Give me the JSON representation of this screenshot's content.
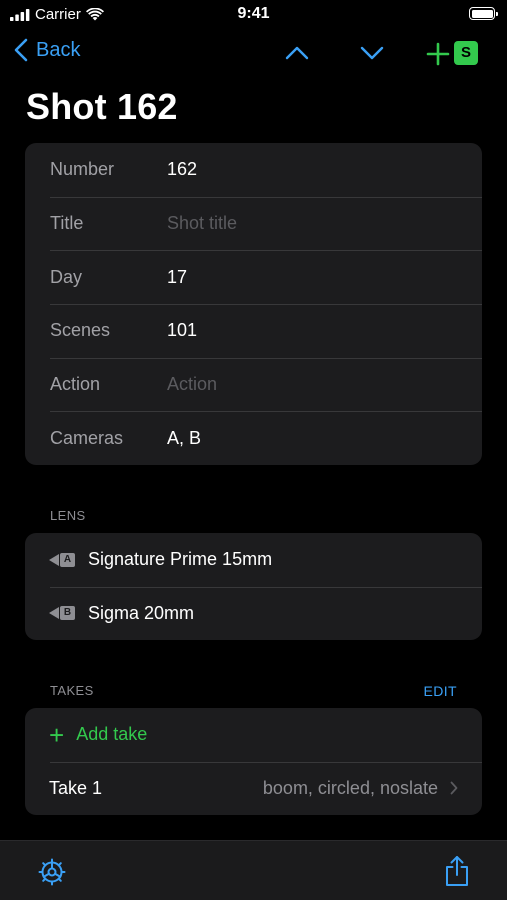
{
  "status_bar": {
    "carrier": "Carrier",
    "time": "9:41"
  },
  "nav": {
    "back_label": "Back",
    "badge": "S"
  },
  "page_title": "Shot 162",
  "details": [
    {
      "label": "Number",
      "value": "162",
      "placeholder": false
    },
    {
      "label": "Title",
      "value": "Shot title",
      "placeholder": true
    },
    {
      "label": "Day",
      "value": "17",
      "placeholder": false
    },
    {
      "label": "Scenes",
      "value": "101",
      "placeholder": false
    },
    {
      "label": "Action",
      "value": "Action",
      "placeholder": true
    },
    {
      "label": "Cameras",
      "value": "A, B",
      "placeholder": false
    }
  ],
  "lens": {
    "header": "LENS",
    "items": [
      {
        "camera": "A",
        "name": "Signature Prime 15mm",
        "icon": "camera-a-icon"
      },
      {
        "camera": "B",
        "name": "Sigma 20mm",
        "icon": "camera-b-icon"
      }
    ]
  },
  "takes": {
    "header": "TAKES",
    "edit_label": "EDIT",
    "add_label": "Add take",
    "items": [
      {
        "name": "Take 1",
        "tags": "boom, circled, noslate"
      }
    ]
  },
  "colors": {
    "accent": "#3aa0f5",
    "green": "#33c94d",
    "card": "#1c1c1e"
  },
  "icons": [
    "signal-icon",
    "wifi-icon",
    "battery-icon",
    "chevron-left-icon",
    "chevron-up-icon",
    "chevron-down-icon",
    "plus-icon",
    "gear-icon",
    "share-icon"
  ]
}
